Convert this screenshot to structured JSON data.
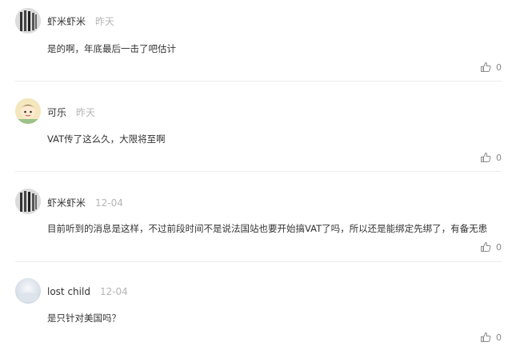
{
  "comments": [
    {
      "avatar": "bars-avatar",
      "name": "虾米虾米",
      "time": "昨天",
      "text": "是的啊，年底最后一击了吧估计",
      "likes": "0"
    },
    {
      "avatar": "cartoon-avatar",
      "name": "可乐",
      "time": "昨天",
      "text": "VAT传了这么久，大限将至啊",
      "likes": "0"
    },
    {
      "avatar": "bars-avatar",
      "name": "虾米虾米",
      "time": "12-04",
      "text": "目前听到的消息是这样，不过前段时间不是说法国站也要开始搞VAT了吗，所以还是能绑定先绑了，有备无患",
      "likes": "0"
    },
    {
      "avatar": "plain-avatar",
      "name": "lost child",
      "time": "12-04",
      "text": "是只针对美国吗？",
      "likes": "0"
    }
  ],
  "icons": {
    "like": "thumbs-up-icon"
  },
  "colors": {
    "name": "#333333",
    "time": "#b5b5b5",
    "divider": "#ececec",
    "like_count": "#888888"
  }
}
